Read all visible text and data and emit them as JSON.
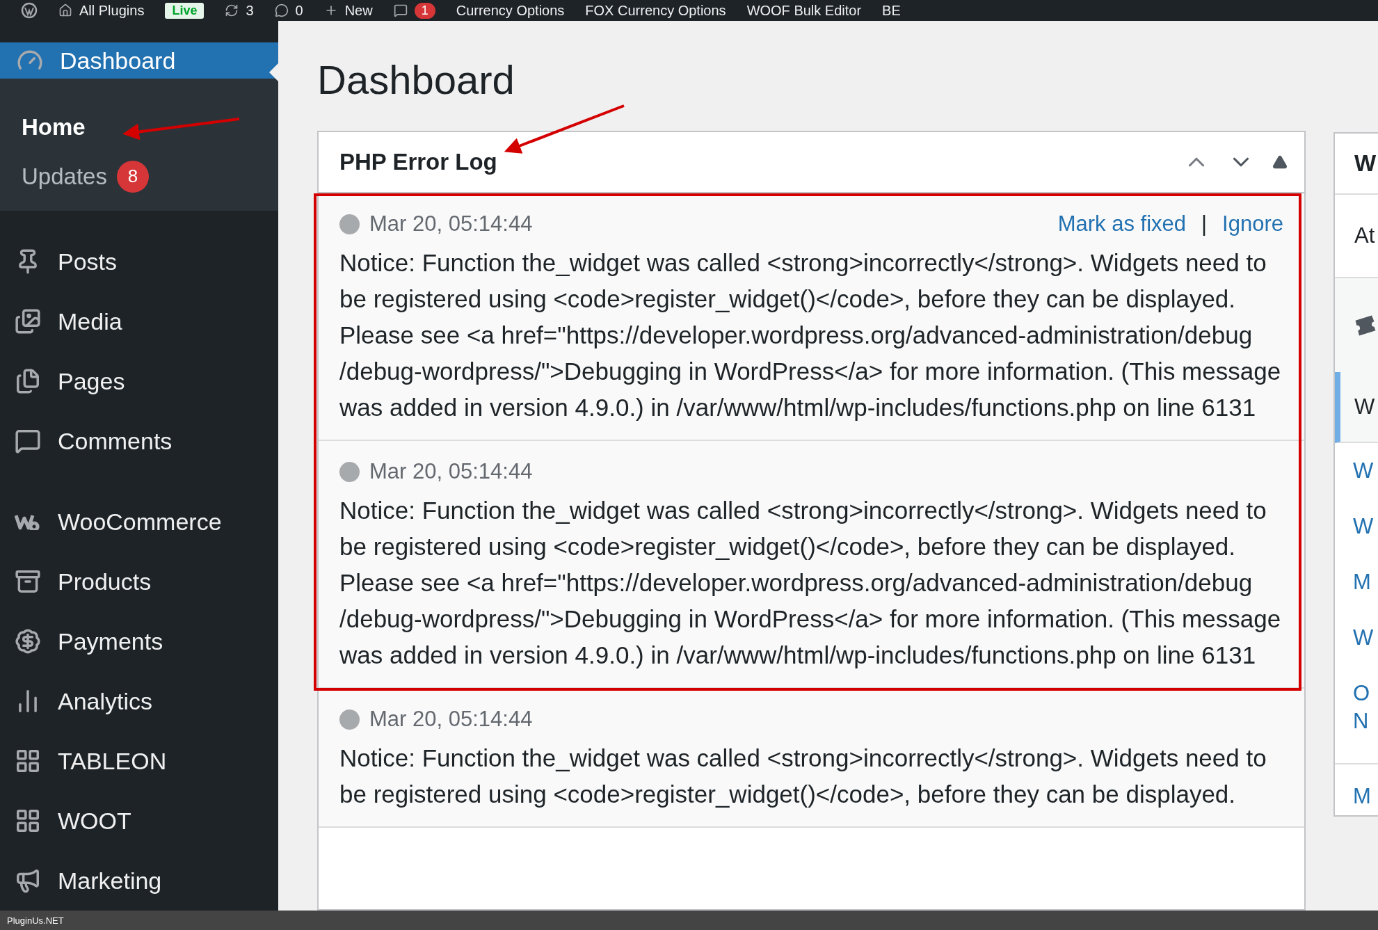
{
  "admin_bar": {
    "items": [
      {
        "kind": "logo"
      },
      {
        "kind": "home",
        "label": "All Plugins"
      },
      {
        "kind": "badge",
        "label": "Live"
      },
      {
        "kind": "updates",
        "label": "3"
      },
      {
        "kind": "comments",
        "label": "0"
      },
      {
        "kind": "new",
        "label": "New"
      },
      {
        "kind": "notify",
        "label": "1"
      },
      {
        "kind": "text",
        "label": "Currency Options"
      },
      {
        "kind": "text",
        "label": "FOX Currency Options"
      },
      {
        "kind": "text",
        "label": "WOOF Bulk Editor"
      },
      {
        "kind": "text",
        "label": "BE"
      }
    ]
  },
  "sidebar": {
    "current": {
      "label": "Dashboard",
      "selected": true
    },
    "submenu": [
      {
        "label": "Home",
        "selected": true
      },
      {
        "label": "Updates",
        "selected": false,
        "badge": "8"
      }
    ],
    "menu_groups": [
      [
        {
          "label": "Posts"
        },
        {
          "label": "Media"
        },
        {
          "label": "Pages"
        },
        {
          "label": "Comments"
        }
      ],
      [
        {
          "label": "WooCommerce"
        },
        {
          "label": "Products"
        },
        {
          "label": "Payments"
        },
        {
          "label": "Analytics"
        },
        {
          "label": "TABLEON"
        },
        {
          "label": "WOOT"
        },
        {
          "label": "Marketing"
        }
      ]
    ]
  },
  "page_title": "Dashboard",
  "widget": {
    "title": "PHP Error Log",
    "entries": [
      {
        "time": "Mar 20, 05:14:44",
        "actions": {
          "mark": "Mark as fixed",
          "separator": "|",
          "ignore": "Ignore"
        },
        "message": "Notice: Function the_widget was called <strong>incorrectly</strong>. Widgets need to be registered using <code>register_widget()</code>, before they can be displayed. Please see <a href=\"https://developer.wordpress.org/advanced-administration/debug /debug-wordpress/\">Debugging in WordPress</a> for more information. (This message was added in version 4.9.0.) in /var/www/html/wp-includes/functions.php on line 6131"
      },
      {
        "time": "Mar 20, 05:14:44",
        "message": "Notice: Function the_widget was called <strong>incorrectly</strong>. Widgets need to be registered using <code>register_widget()</code>, before they can be displayed. Please see <a href=\"https://developer.wordpress.org/advanced-administration/debug /debug-wordpress/\">Debugging in WordPress</a> for more information. (This message was added in version 4.9.0.) in /var/www/html/wp-includes/functions.php on line 6131"
      },
      {
        "time": "Mar 20, 05:14:44",
        "message": "Notice: Function the_widget was called <strong>incorrectly</strong>. Widgets need to be registered using <code>register_widget()</code>, before they can be displayed."
      }
    ]
  },
  "side_widget": {
    "title": "W",
    "intro": "At",
    "tab": "W",
    "links": [
      "W",
      "W",
      "M",
      "W",
      "O N"
    ],
    "footer_link": "M"
  },
  "footer": {
    "text": "PluginUs.NET"
  }
}
